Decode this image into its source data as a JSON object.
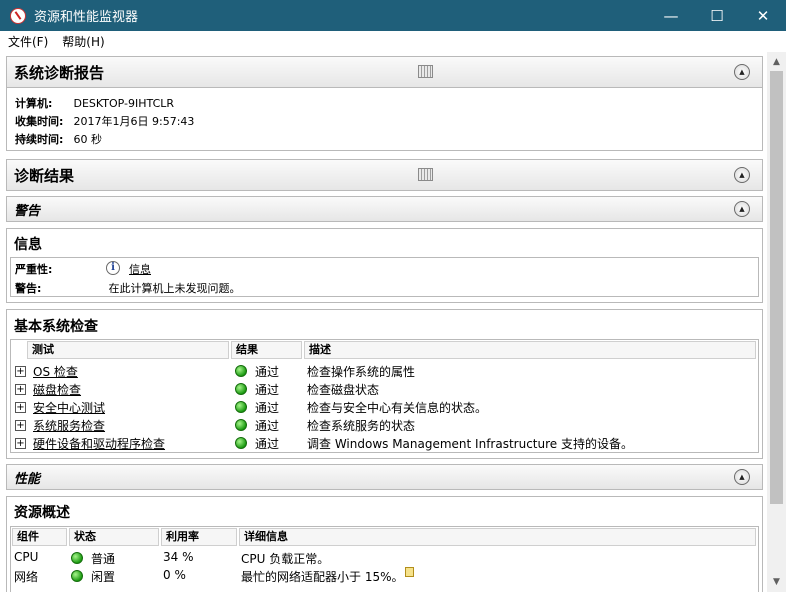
{
  "window": {
    "title": "资源和性能监视器",
    "minimize": "—",
    "maximize": "☐",
    "close": "✕"
  },
  "menu": {
    "file": "文件(F)",
    "help": "帮助(H)"
  },
  "report": {
    "header": "系统诊断报告",
    "computer_label": "计算机:",
    "computer_value": "DESKTOP-9IHTCLR",
    "collect_label": "收集时间:",
    "collect_value": "2017年1月6日  9:57:43",
    "duration_label": "持续时间:",
    "duration_value": "60 秒"
  },
  "diagnosis": {
    "header": "诊断结果"
  },
  "warning": {
    "header": "警告"
  },
  "info": {
    "title": "信息",
    "severity_label": "严重性:",
    "severity_value": "信息",
    "warning_label": "警告:",
    "warning_value": "在此计算机上未发现问题。"
  },
  "basic_checks": {
    "title": "基本系统检查",
    "columns": [
      "测试",
      "结果",
      "描述"
    ],
    "rows": [
      {
        "test": "OS 检查",
        "result": "通过",
        "desc": "检查操作系统的属性"
      },
      {
        "test": "磁盘检查",
        "result": "通过",
        "desc": "检查磁盘状态"
      },
      {
        "test": "安全中心测试",
        "result": "通过",
        "desc": "检查与安全中心有关信息的状态。"
      },
      {
        "test": "系统服务检查",
        "result": "通过",
        "desc": "检查系统服务的状态"
      },
      {
        "test": "硬件设备和驱动程序检查",
        "result": "通过",
        "desc": "调查  Windows Management Infrastructure 支持的设备。"
      }
    ]
  },
  "performance": {
    "header": "性能"
  },
  "resource_overview": {
    "title": "资源概述",
    "columns": [
      "组件",
      "状态",
      "利用率",
      "详细信息"
    ],
    "rows": [
      {
        "component": "CPU",
        "status": "普通",
        "usage": "34 %",
        "detail": "CPU 负载正常。"
      },
      {
        "component": "网络",
        "status": "闲置",
        "usage": "0 %",
        "detail": "最忙的网络适配器小于  15%。"
      }
    ]
  },
  "colors": {
    "titlebar": "#1f5f7a",
    "pass_green": "#1c9b12"
  }
}
